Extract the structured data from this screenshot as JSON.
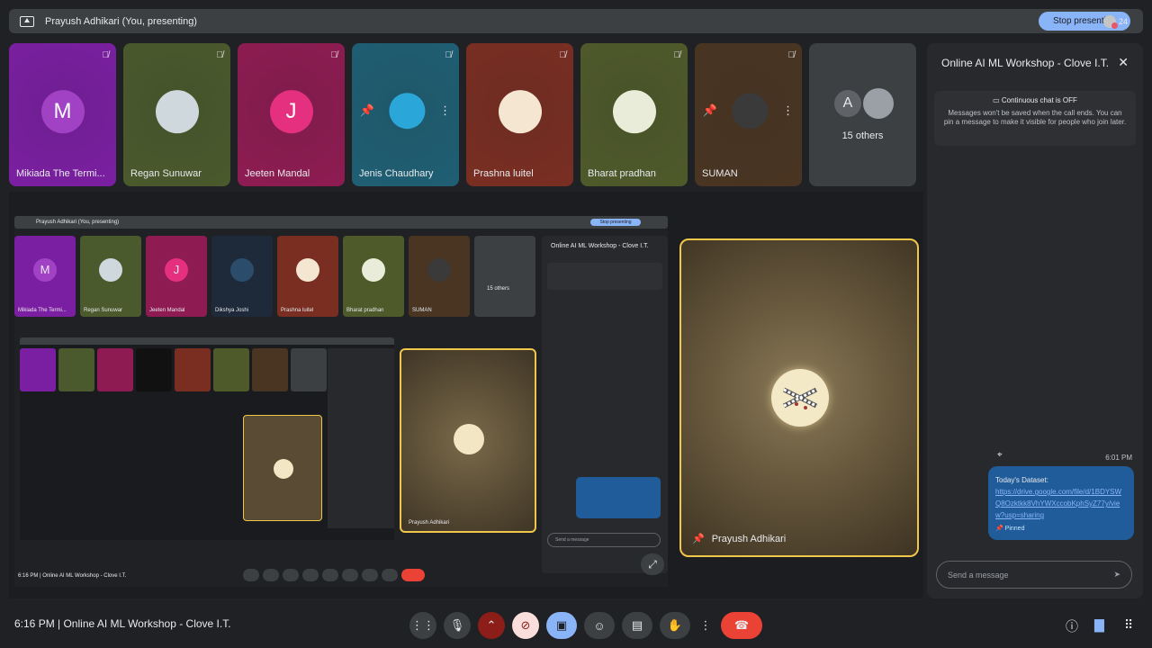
{
  "topbar": {
    "title": "Prayush Adhikari (You, presenting)",
    "stop_label": "Stop presenting",
    "people_count": "24"
  },
  "tiles": [
    {
      "name": "Mikiada The Termi...",
      "initial": "M",
      "bg": "#7b1fa2",
      "avatar_bg": "#a142c4",
      "type": "letter"
    },
    {
      "name": "Regan Sunuwar",
      "bg": "#4a5a2c",
      "avatar_bg": "#cfd8dc",
      "type": "photo"
    },
    {
      "name": "Jeeten Mandal",
      "initial": "J",
      "bg": "#8e1c52",
      "avatar_bg": "#e52f7f",
      "type": "letter"
    },
    {
      "name": "Jenis Chaudhary",
      "bg": "#1f5f74",
      "avatar_bg": "#2aa7d8",
      "type": "controls"
    },
    {
      "name": "Prashna luitel",
      "bg": "#7a2e22",
      "avatar_bg": "#f4e6d0",
      "type": "photo"
    },
    {
      "name": "Bharat pradhan",
      "bg": "#4f5a2a",
      "avatar_bg": "#e8ecd8",
      "type": "photo"
    },
    {
      "name": "SUMAN",
      "bg": "#4a3522",
      "avatar_bg": "#3a3a3a",
      "type": "controls"
    }
  ],
  "others": {
    "initial": "A",
    "label": "15 others"
  },
  "chat": {
    "title": "Online AI ML Workshop - Clove I.T.",
    "notice_title": "Continuous chat is OFF",
    "notice_text": "Messages won't be saved when the call ends. You can pin a message to make it visible for people who join later.",
    "time": "6:01 PM",
    "message_title": "Today's Dataset:",
    "message_link": "https://drive.google.com/file/d/1BDYSWQ8Ozktkk8VhYWXccobKphSyZ77y/view?usp=sharing",
    "pinned_label": "Pinned",
    "input_placeholder": "Send a message"
  },
  "mini": {
    "topbar_title": "Prayush Adhikari (You, presenting)",
    "stop_label": "Stop presenting",
    "chat_title": "Online AI ML Workshop - Clove I.T.",
    "input_placeholder": "Send a message",
    "pinned_name": "Prayush Adhikari",
    "bar_text": "6:16 PM  |  Online AI ML Workshop - Clove I.T.",
    "others_label": "15 others",
    "tiles": [
      {
        "name": "Mikiada The Termi...",
        "initial": "M",
        "bg": "#7b1fa2",
        "avatar_bg": "#a142c4"
      },
      {
        "name": "Regan Sunuwar",
        "initial": "",
        "bg": "#4a5a2c",
        "avatar_bg": "#cfd8dc"
      },
      {
        "name": "Jeeten Mandal",
        "initial": "J",
        "bg": "#8e1c52",
        "avatar_bg": "#e52f7f"
      },
      {
        "name": "Dikshya Joshi",
        "initial": "",
        "bg": "#1e2a3a",
        "avatar_bg": "#2b4c6b"
      },
      {
        "name": "Prashna luitel",
        "initial": "",
        "bg": "#7a2e22",
        "avatar_bg": "#f4e6d0"
      },
      {
        "name": "Bharat pradhan",
        "initial": "",
        "bg": "#4f5a2a",
        "avatar_bg": "#e8ecd8"
      },
      {
        "name": "SUMAN",
        "initial": "",
        "bg": "#4a3522",
        "avatar_bg": "#3a3a3a"
      }
    ]
  },
  "pinned": {
    "name": "Prayush Adhikari"
  },
  "bottom": {
    "meeting_text": "6:16 PM  |  Online AI ML Workshop - Clove I.T."
  },
  "colors": {
    "accent": "#8ab4f8",
    "pin_border": "#f0c64b",
    "end_call": "#ea4335"
  }
}
